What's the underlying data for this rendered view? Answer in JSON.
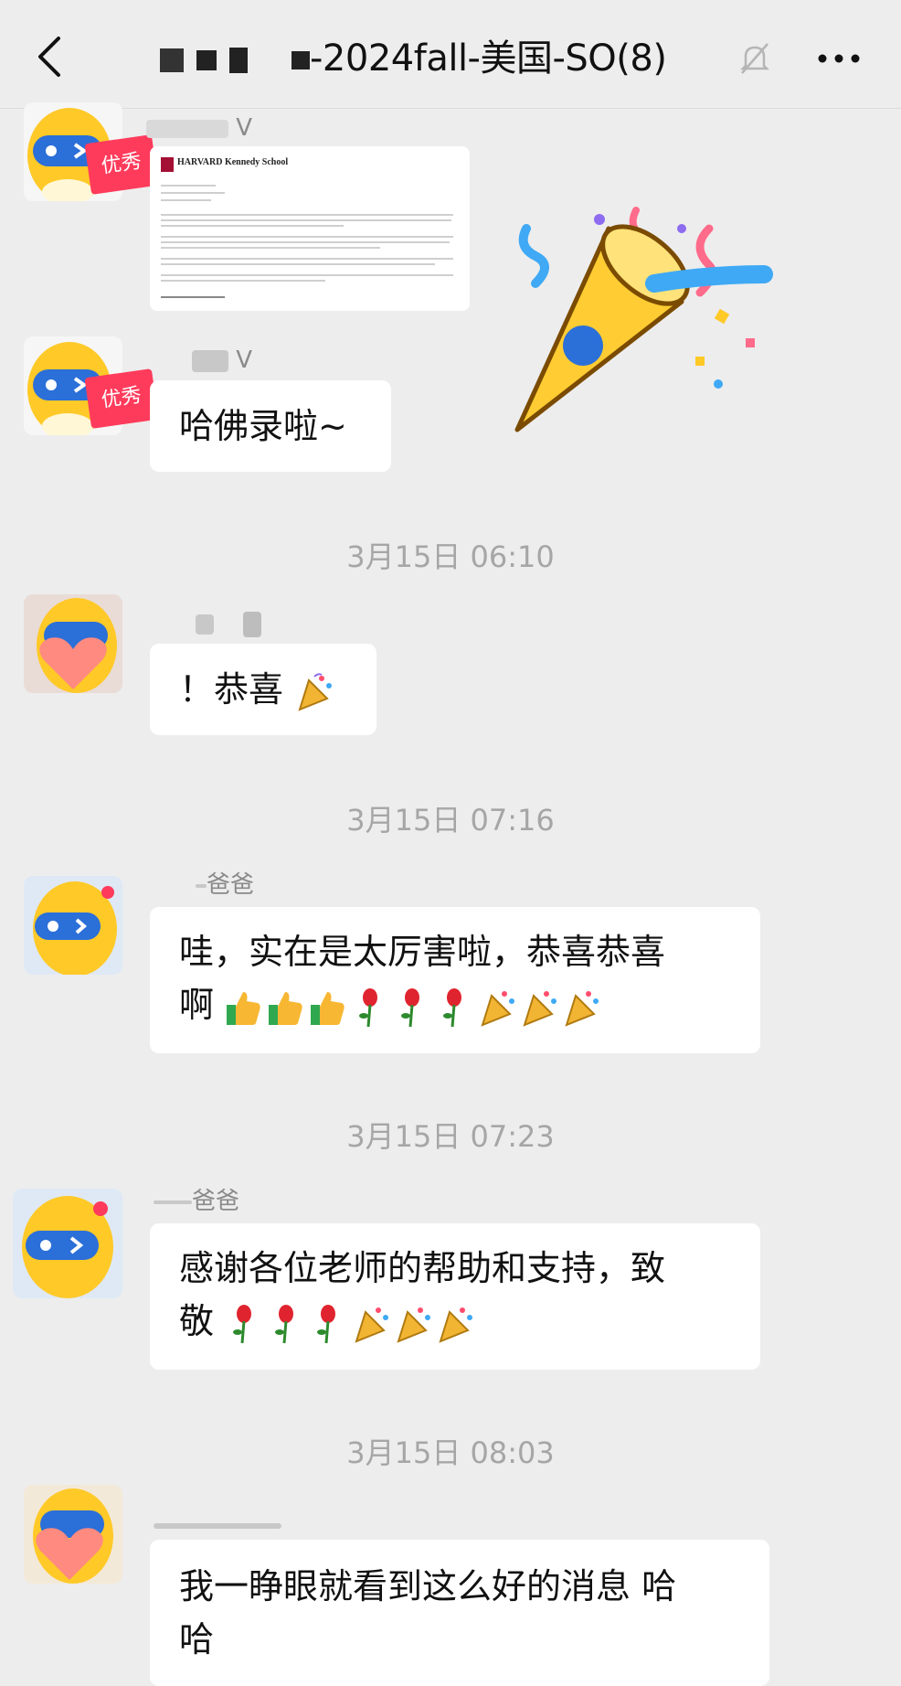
{
  "header": {
    "title_suffix": "-2024fall-美国-SO(8)",
    "icons": {
      "back": "chevron-left-icon",
      "mute": "bell-muted-icon",
      "more": "more-dots-icon"
    }
  },
  "messages": [
    {
      "sender_suffix": "V",
      "type": "image",
      "doc_title": "HARVARD Kennedy School",
      "badge": "优秀"
    },
    {
      "sender_suffix": "V",
      "type": "text",
      "text": "哈佛录啦~",
      "badge": "优秀"
    },
    {
      "time": "3月15日 06:10"
    },
    {
      "sender_suffix": "",
      "type": "text",
      "text": "！恭喜"
    },
    {
      "time": "3月15日 07:16"
    },
    {
      "sender_suffix": "爸爸",
      "type": "text",
      "line1": "哇，实在是太厉害啦，恭喜恭喜",
      "line2": "啊"
    },
    {
      "time": "3月15日 07:23"
    },
    {
      "sender_suffix": "爸爸",
      "type": "text",
      "line1": "感谢各位老师的帮助和支持，致",
      "line2": "敬"
    },
    {
      "time": "3月15日 08:03"
    },
    {
      "sender_suffix": "",
      "type": "text",
      "line1": "我一睁眼就看到这么好的消息 哈",
      "line2": "哈"
    }
  ],
  "colors": {
    "background": "#ededed",
    "bubble": "#ffffff",
    "badge": "#ff3b5c",
    "time_text": "#a6a6a6"
  }
}
